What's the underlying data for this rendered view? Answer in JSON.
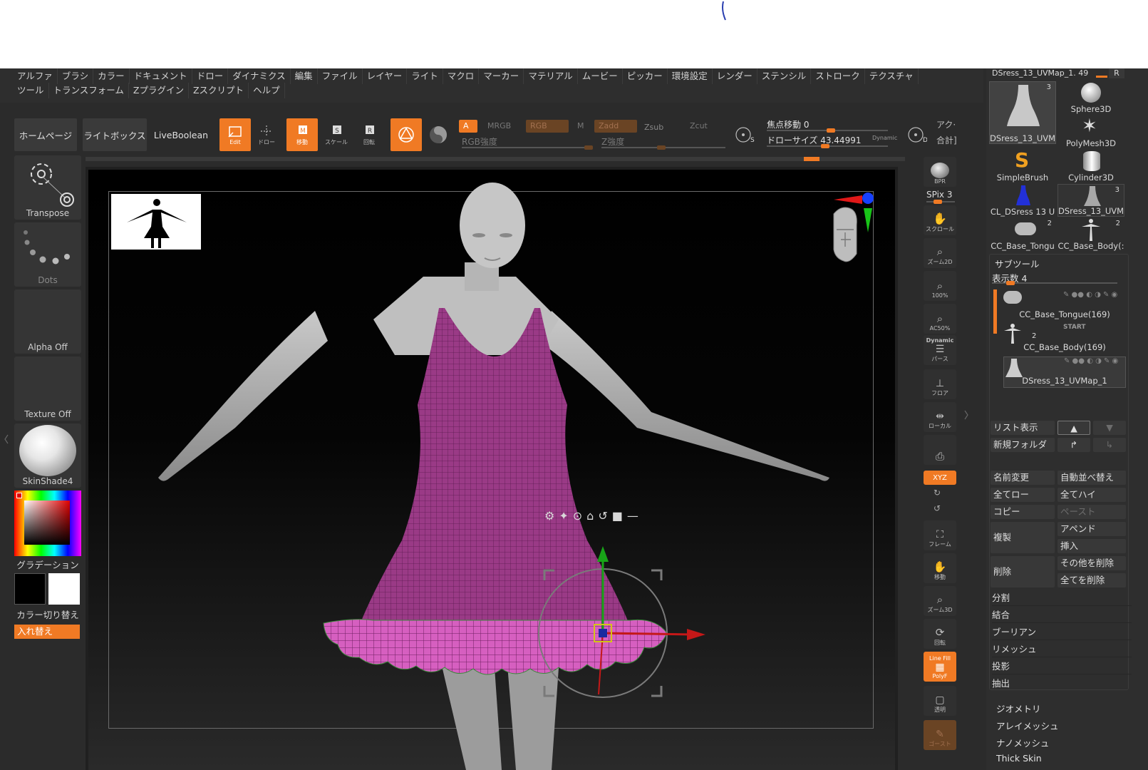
{
  "menu": {
    "row1": [
      "アルファ",
      "ブラシ",
      "カラー",
      "ドキュメント",
      "ドロー",
      "ダイナミクス",
      "編集",
      "ファイル",
      "レイヤー",
      "ライト",
      "マクロ",
      "マーカー",
      "マテリアル",
      "ムービー",
      "ピッカー",
      "環境設定",
      "レンダー",
      "ステンシル",
      "ストローク",
      "テクスチャ"
    ],
    "row2": [
      "ツール",
      "トランスフォーム",
      "Zプラグイン",
      "Zスクリプト",
      "ヘルプ"
    ]
  },
  "toolbar": {
    "homepage": "ホームページ",
    "lightbox": "ライトボックス",
    "liveboolean": "LiveBoolean",
    "edit": "Edit",
    "draw": "ドロー",
    "move": "移動",
    "scale": "スケール",
    "rotate": "回転",
    "mode_a": "A",
    "mrgb": "MRGB",
    "rgb": "RGB",
    "m": "M",
    "zadd": "Zadd",
    "zsub": "Zsub",
    "zcut": "Zcut",
    "rgb_intensity": "RGB強度",
    "z_intensity": "Z強度",
    "focal_shift": "焦点移動 0",
    "draw_size": "ドローサイズ 43.44991",
    "dynamic": "Dynamic",
    "active_points": "アク·",
    "total_points": "合計]",
    "s_label": "S",
    "d_label": "D"
  },
  "left": {
    "transpose": "Transpose",
    "dots": "Dots",
    "alpha": "Alpha Off",
    "texture": "Texture Off",
    "material": "SkinShade4",
    "gradation": "グラデーション",
    "color_switch": "カラー切り替え",
    "swap": "入れ替え"
  },
  "rightbar": {
    "bpr": "BPR",
    "spix": "SPix 3",
    "scroll": "スクロール",
    "zoom2d": "ズーム2D",
    "hundred": "100%",
    "ac50": "AC50%",
    "dynamic": "Dynamic",
    "perspective": "パース",
    "floor": "フロア",
    "local": "ローカル",
    "xyz": "XYZ",
    "frame": "フレーム",
    "move": "移動",
    "zoom3d": "ズーム3D",
    "rotate": "回転",
    "linefill": "Line Fill",
    "polyf": "PolyF",
    "transparent": "透明",
    "ghost": "ゴースト"
  },
  "toolpanel": {
    "current_tool": "DSress_13_UVMap_1. 49",
    "r_btn": "R",
    "tools": [
      {
        "name": "DSress_13_UVM",
        "count": "3"
      },
      {
        "name": "Sphere3D",
        "count": ""
      },
      {
        "name": "",
        "count": ""
      },
      {
        "name": "PolyMesh3D",
        "count": ""
      },
      {
        "name": "SimpleBrush",
        "count": ""
      },
      {
        "name": "Cylinder3D",
        "count": ""
      },
      {
        "name": "CL_DSress 13 U",
        "count": ""
      },
      {
        "name": "DSress_13_UVM",
        "count": "3"
      },
      {
        "name": "CC_Base_Tongu",
        "count": "2"
      },
      {
        "name": "CC_Base_Body(:",
        "count": "2"
      }
    ],
    "subtool_title": "サブツール",
    "display_count": "表示数 4",
    "subtools": [
      {
        "name": "CC_Base_Tongue(169)",
        "badge": ""
      },
      {
        "name": "CC_Base_Body(169)",
        "badge": "2",
        "start": "START"
      },
      {
        "name": "DSress_13_UVMap_1",
        "badge": ""
      }
    ],
    "list_view": "リスト表示",
    "new_folder": "新規フォルダ",
    "buttons_left": [
      "名前変更",
      "全てロー",
      "コピー",
      "複製",
      "削除"
    ],
    "buttons_right": [
      "自動並べ替え",
      "全てハイ",
      "ペースト",
      "アペンド",
      "挿入",
      "その他を削除",
      "全てを削除"
    ],
    "rows": [
      "分割",
      "結合",
      "ブーリアン",
      "リメッシュ",
      "投影",
      "抽出"
    ],
    "sections": [
      "ジオメトリ",
      "アレイメッシュ",
      "ナノメッシュ",
      "Thick Skin"
    ]
  },
  "colors": {
    "accent": "#f07a24",
    "dress": "#9a3a86",
    "ruffle": "#d65fc0"
  }
}
